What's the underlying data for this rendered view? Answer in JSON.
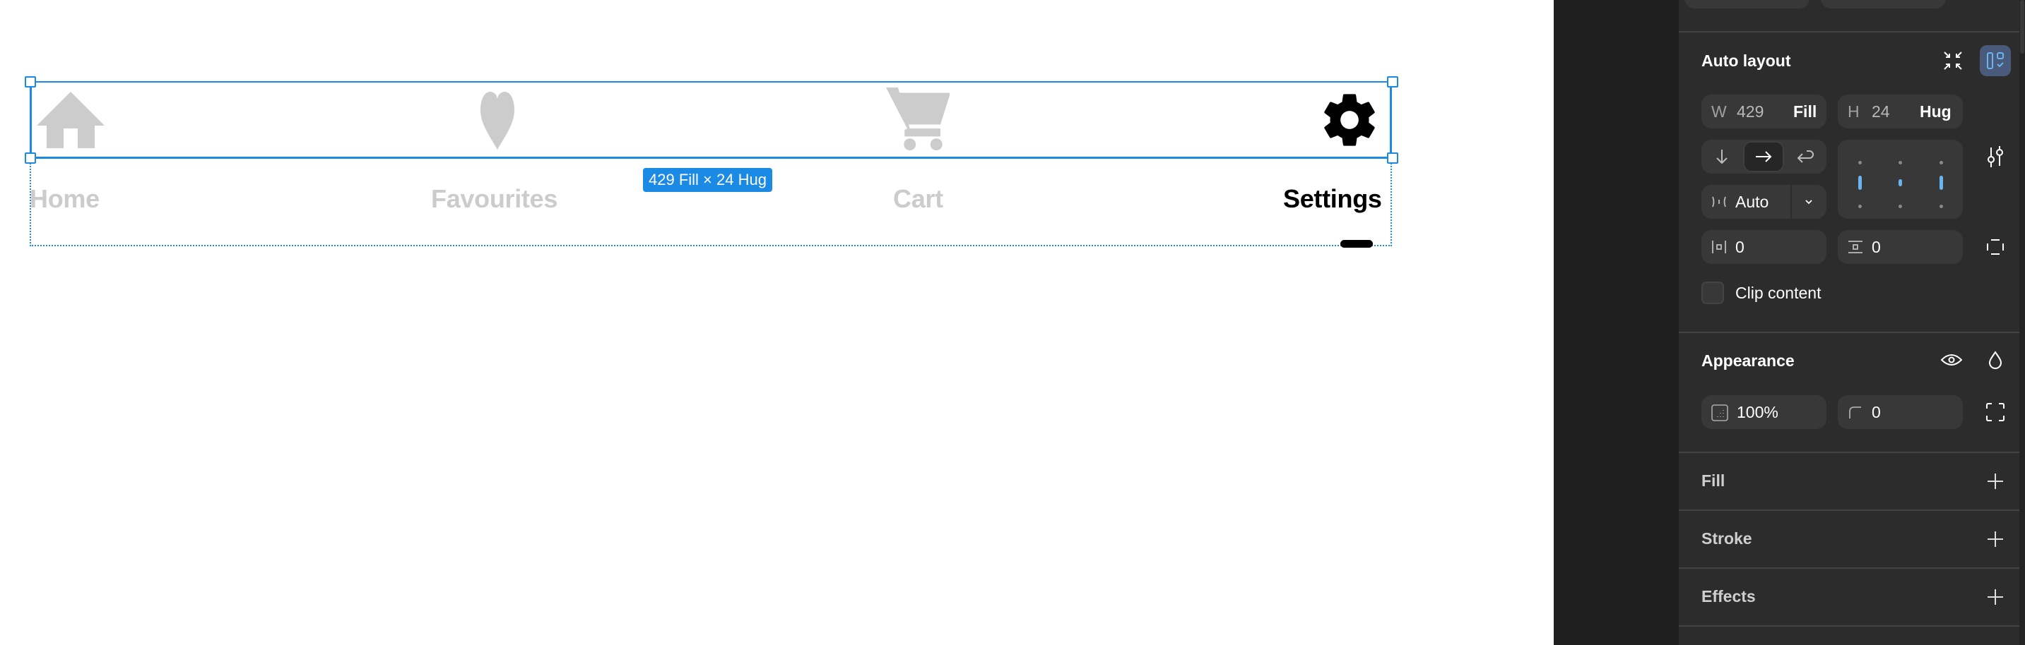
{
  "canvas": {
    "nav_items": [
      {
        "label": "Home",
        "icon": "home-icon",
        "active": false
      },
      {
        "label": "Favourites",
        "icon": "heart-icon",
        "active": false
      },
      {
        "label": "Cart",
        "icon": "cart-icon",
        "active": false
      },
      {
        "label": "Settings",
        "icon": "gear-icon",
        "active": true
      }
    ],
    "size_badge": "429 Fill × 24 Hug",
    "colors": {
      "inactive": "#cccccc",
      "active": "#000000",
      "selection": "#1a8ae5"
    }
  },
  "panel": {
    "auto_layout": {
      "title": "Auto layout",
      "width": {
        "label": "W",
        "value": "429",
        "mode": "Fill"
      },
      "height": {
        "label": "H",
        "value": "24",
        "mode": "Hug"
      },
      "direction_options": [
        "vertical",
        "horizontal",
        "wrap"
      ],
      "direction_selected": "horizontal",
      "gap": {
        "value": "Auto"
      },
      "horizontal_padding": {
        "value": "0"
      },
      "vertical_padding": {
        "value": "0"
      },
      "clip_content": {
        "label": "Clip content",
        "checked": false
      }
    },
    "appearance": {
      "title": "Appearance",
      "opacity": "100%",
      "corner_radius": "0"
    },
    "fill": {
      "title": "Fill"
    },
    "stroke": {
      "title": "Stroke"
    },
    "effects": {
      "title": "Effects"
    },
    "colors": {
      "panel_bg": "#2c2c2c",
      "field_bg": "#383838",
      "accent": "#6ab4f0",
      "toggle_active_bg": "#4a5a7a"
    }
  }
}
